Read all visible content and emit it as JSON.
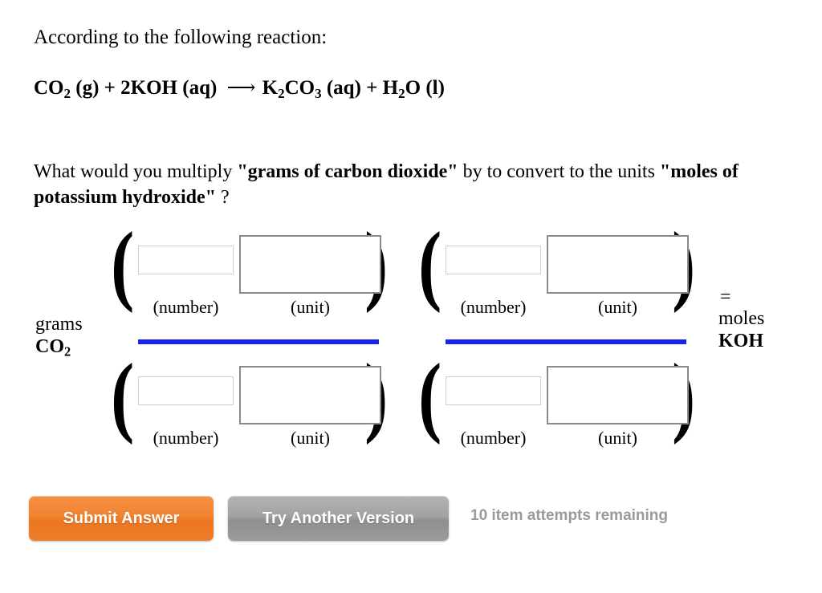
{
  "prompt": {
    "intro": "According to the following reaction:",
    "equation": {
      "reactant1": "CO",
      "reactant1_sub": "2",
      "reactant1_phase": "(g)",
      "plus1": "+",
      "reactant2_coeff": "2KOH",
      "reactant2_phase": "(aq)",
      "arrow": "⟶",
      "product1_a": "K",
      "product1_a_sub": "2",
      "product1_b": "CO",
      "product1_b_sub": "3",
      "product1_phase": "(aq)",
      "plus2": "+",
      "product2_a": "H",
      "product2_a_sub": "2",
      "product2_b": "O",
      "product2_phase": "(l)"
    },
    "question_part1": "What would you multiply ",
    "question_bold1": "\"grams of carbon dioxide\"",
    "question_part2": " by to convert to the units ",
    "question_bold2": "\"moles of potassium hydroxide\"",
    "question_part3": " ?"
  },
  "expression": {
    "left_label_top": "grams",
    "left_label_bottom": "CO",
    "left_label_bottom_sub": "2",
    "equals": "=",
    "right_label_top": "moles",
    "right_label_bottom": "KOH",
    "bar_color": "#1822ef",
    "caption_number": "(number)",
    "caption_unit": "(unit)",
    "factors": [
      {
        "id": "factor-1",
        "numerator": {
          "number": "",
          "unit": ""
        },
        "denominator": {
          "number": "",
          "unit": ""
        }
      },
      {
        "id": "factor-2",
        "numerator": {
          "number": "",
          "unit": ""
        },
        "denominator": {
          "number": "",
          "unit": ""
        }
      }
    ],
    "paren_open": "(",
    "paren_close": ")"
  },
  "actions": {
    "submit_label": "Submit Answer",
    "another_label": "Try Another Version",
    "attempts_text": "10 item attempts remaining",
    "submit_color": "#ef7f2b",
    "another_color": "#9c9c9c"
  }
}
